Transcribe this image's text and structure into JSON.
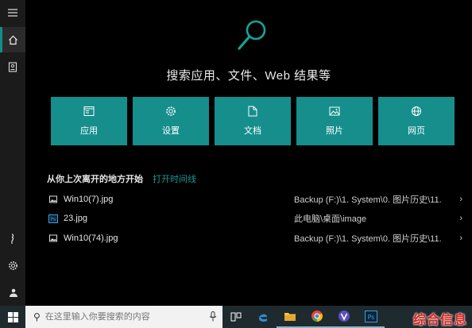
{
  "search": {
    "hint": "搜索应用、文件、Web 结果等",
    "placeholder": "在这里输入你要搜索的内容"
  },
  "categories": [
    {
      "label": "应用",
      "icon": "app-window-icon"
    },
    {
      "label": "设置",
      "icon": "gear-icon"
    },
    {
      "label": "文档",
      "icon": "document-icon"
    },
    {
      "label": "照片",
      "icon": "photo-icon"
    },
    {
      "label": "网页",
      "icon": "globe-icon"
    }
  ],
  "recent": {
    "title": "从你上次离开的地方开始",
    "link": "打开时间线",
    "items": [
      {
        "name": "Win10(7).jpg",
        "path": "Backup (F:)\\1. System\\0. 图片历史\\11.",
        "icon": "image-file-icon"
      },
      {
        "name": "23.jpg",
        "path": "此电脑\\桌面\\image",
        "icon": "ps-file-icon"
      },
      {
        "name": "Win10(74).jpg",
        "path": "Backup (F:)\\1. System\\0. 图片历史\\11.",
        "icon": "image-file-icon"
      }
    ]
  },
  "sidebar": {
    "items": [
      "hamburger-menu-icon",
      "home-icon",
      "notebook-icon",
      "voice-icon",
      "gear-icon",
      "user-icon"
    ]
  },
  "taskbar": {
    "apps": [
      "task-view-icon",
      "edge-icon",
      "file-explorer-icon",
      "chrome-icon",
      "app-v-icon",
      "photoshop-icon"
    ]
  },
  "watermark": "综合信息",
  "colors": {
    "accent": "#168e8c",
    "link": "#1a9a8f",
    "brand": "#e0201a"
  }
}
